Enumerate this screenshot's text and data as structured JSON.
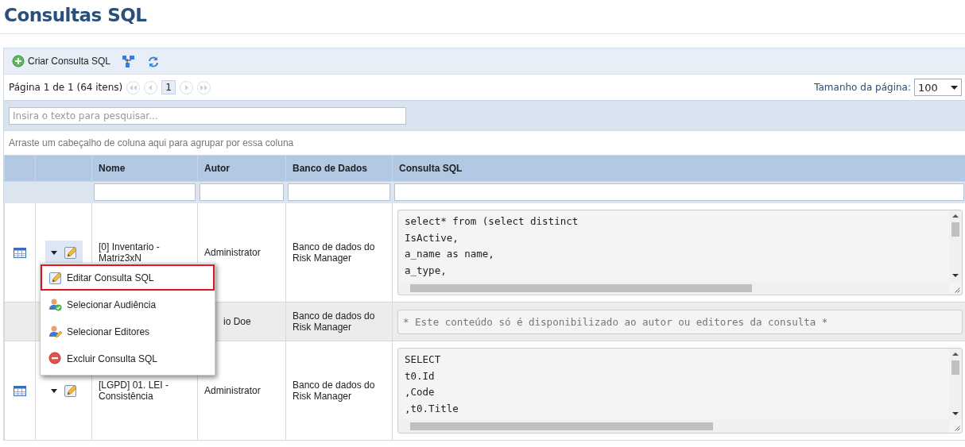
{
  "page_title": "Consultas SQL",
  "toolbar": {
    "create_label": "Criar Consulta SQL"
  },
  "pager": {
    "summary": "Página 1 de 1 (64 itens)",
    "pages": [
      {
        "label": "1",
        "selected": true
      }
    ],
    "page_size_label": "Tamanho da página:",
    "page_size": "100"
  },
  "search": {
    "placeholder": "Insira o texto para pesquisar..."
  },
  "group_panel": "Arraste um cabeçalho de coluna aqui para agrupar por essa coluna",
  "table": {
    "columns": [
      "Nome",
      "Autor",
      "Banco de Dados",
      "Consulta SQL"
    ],
    "rows": [
      {
        "view_icon": true,
        "actions": true,
        "menu_open": true,
        "name": "[0] Inventario - Matriz3xN",
        "author": "Administrator",
        "author_cut": false,
        "database": "Banco de dados do Risk Manager",
        "sql": {
          "kind": "code",
          "lines": [
            "select* from (select distinct",
            "IsActive,",
            "a_name as name,",
            "a_type,"
          ]
        },
        "shaded": false
      },
      {
        "view_icon": false,
        "actions": false,
        "author": "io Doe",
        "author_cut": true,
        "database": "Banco de dados do Risk Manager",
        "sql": {
          "kind": "notice",
          "text": "* Este conteúdo só é disponibilizado ao autor ou editores da consulta *"
        },
        "shaded": true
      },
      {
        "view_icon": true,
        "actions": true,
        "menu_open": false,
        "name": "[LGPD] 01. LEI - Consistência",
        "author": "Administrator",
        "author_cut": false,
        "database": "Banco de dados do Risk Manager",
        "sql": {
          "kind": "code",
          "lines": [
            "SELECT",
            "t0.Id",
            ",Code",
            ",t0.Title"
          ]
        },
        "shaded": false
      }
    ]
  },
  "context_menu": {
    "items": [
      {
        "kind": "edit",
        "label": "Editar Consulta SQL",
        "selected": true
      },
      {
        "kind": "audience",
        "label": "Selecionar Audiência",
        "selected": false
      },
      {
        "kind": "editors",
        "label": "Selecionar Editores",
        "selected": false
      },
      {
        "kind": "delete",
        "label": "Excluir Consulta SQL",
        "selected": false
      }
    ]
  }
}
